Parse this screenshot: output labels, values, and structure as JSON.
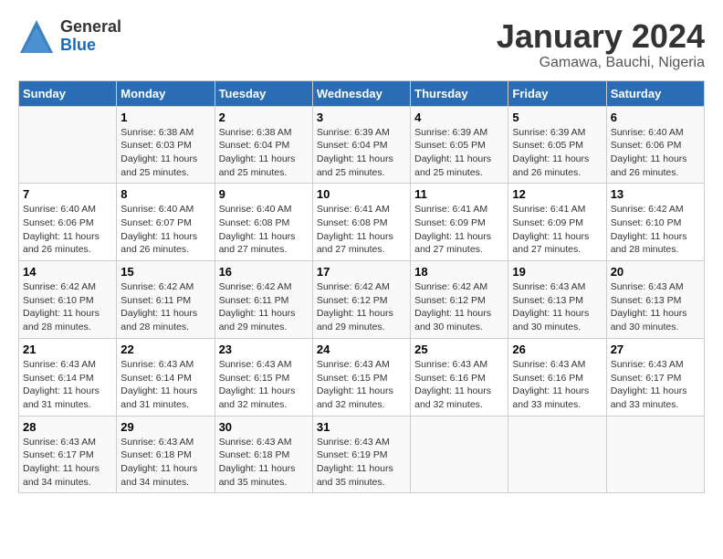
{
  "header": {
    "logo": {
      "general": "General",
      "blue": "Blue"
    },
    "title": "January 2024",
    "subtitle": "Gamawa, Bauchi, Nigeria"
  },
  "calendar": {
    "days_of_week": [
      "Sunday",
      "Monday",
      "Tuesday",
      "Wednesday",
      "Thursday",
      "Friday",
      "Saturday"
    ],
    "weeks": [
      [
        {
          "day": "",
          "info": ""
        },
        {
          "day": "1",
          "info": "Sunrise: 6:38 AM\nSunset: 6:03 PM\nDaylight: 11 hours\nand 25 minutes."
        },
        {
          "day": "2",
          "info": "Sunrise: 6:38 AM\nSunset: 6:04 PM\nDaylight: 11 hours\nand 25 minutes."
        },
        {
          "day": "3",
          "info": "Sunrise: 6:39 AM\nSunset: 6:04 PM\nDaylight: 11 hours\nand 25 minutes."
        },
        {
          "day": "4",
          "info": "Sunrise: 6:39 AM\nSunset: 6:05 PM\nDaylight: 11 hours\nand 25 minutes."
        },
        {
          "day": "5",
          "info": "Sunrise: 6:39 AM\nSunset: 6:05 PM\nDaylight: 11 hours\nand 26 minutes."
        },
        {
          "day": "6",
          "info": "Sunrise: 6:40 AM\nSunset: 6:06 PM\nDaylight: 11 hours\nand 26 minutes."
        }
      ],
      [
        {
          "day": "7",
          "info": "Sunrise: 6:40 AM\nSunset: 6:06 PM\nDaylight: 11 hours\nand 26 minutes."
        },
        {
          "day": "8",
          "info": "Sunrise: 6:40 AM\nSunset: 6:07 PM\nDaylight: 11 hours\nand 26 minutes."
        },
        {
          "day": "9",
          "info": "Sunrise: 6:40 AM\nSunset: 6:08 PM\nDaylight: 11 hours\nand 27 minutes."
        },
        {
          "day": "10",
          "info": "Sunrise: 6:41 AM\nSunset: 6:08 PM\nDaylight: 11 hours\nand 27 minutes."
        },
        {
          "day": "11",
          "info": "Sunrise: 6:41 AM\nSunset: 6:09 PM\nDaylight: 11 hours\nand 27 minutes."
        },
        {
          "day": "12",
          "info": "Sunrise: 6:41 AM\nSunset: 6:09 PM\nDaylight: 11 hours\nand 27 minutes."
        },
        {
          "day": "13",
          "info": "Sunrise: 6:42 AM\nSunset: 6:10 PM\nDaylight: 11 hours\nand 28 minutes."
        }
      ],
      [
        {
          "day": "14",
          "info": "Sunrise: 6:42 AM\nSunset: 6:10 PM\nDaylight: 11 hours\nand 28 minutes."
        },
        {
          "day": "15",
          "info": "Sunrise: 6:42 AM\nSunset: 6:11 PM\nDaylight: 11 hours\nand 28 minutes."
        },
        {
          "day": "16",
          "info": "Sunrise: 6:42 AM\nSunset: 6:11 PM\nDaylight: 11 hours\nand 29 minutes."
        },
        {
          "day": "17",
          "info": "Sunrise: 6:42 AM\nSunset: 6:12 PM\nDaylight: 11 hours\nand 29 minutes."
        },
        {
          "day": "18",
          "info": "Sunrise: 6:42 AM\nSunset: 6:12 PM\nDaylight: 11 hours\nand 30 minutes."
        },
        {
          "day": "19",
          "info": "Sunrise: 6:43 AM\nSunset: 6:13 PM\nDaylight: 11 hours\nand 30 minutes."
        },
        {
          "day": "20",
          "info": "Sunrise: 6:43 AM\nSunset: 6:13 PM\nDaylight: 11 hours\nand 30 minutes."
        }
      ],
      [
        {
          "day": "21",
          "info": "Sunrise: 6:43 AM\nSunset: 6:14 PM\nDaylight: 11 hours\nand 31 minutes."
        },
        {
          "day": "22",
          "info": "Sunrise: 6:43 AM\nSunset: 6:14 PM\nDaylight: 11 hours\nand 31 minutes."
        },
        {
          "day": "23",
          "info": "Sunrise: 6:43 AM\nSunset: 6:15 PM\nDaylight: 11 hours\nand 32 minutes."
        },
        {
          "day": "24",
          "info": "Sunrise: 6:43 AM\nSunset: 6:15 PM\nDaylight: 11 hours\nand 32 minutes."
        },
        {
          "day": "25",
          "info": "Sunrise: 6:43 AM\nSunset: 6:16 PM\nDaylight: 11 hours\nand 32 minutes."
        },
        {
          "day": "26",
          "info": "Sunrise: 6:43 AM\nSunset: 6:16 PM\nDaylight: 11 hours\nand 33 minutes."
        },
        {
          "day": "27",
          "info": "Sunrise: 6:43 AM\nSunset: 6:17 PM\nDaylight: 11 hours\nand 33 minutes."
        }
      ],
      [
        {
          "day": "28",
          "info": "Sunrise: 6:43 AM\nSunset: 6:17 PM\nDaylight: 11 hours\nand 34 minutes."
        },
        {
          "day": "29",
          "info": "Sunrise: 6:43 AM\nSunset: 6:18 PM\nDaylight: 11 hours\nand 34 minutes."
        },
        {
          "day": "30",
          "info": "Sunrise: 6:43 AM\nSunset: 6:18 PM\nDaylight: 11 hours\nand 35 minutes."
        },
        {
          "day": "31",
          "info": "Sunrise: 6:43 AM\nSunset: 6:19 PM\nDaylight: 11 hours\nand 35 minutes."
        },
        {
          "day": "",
          "info": ""
        },
        {
          "day": "",
          "info": ""
        },
        {
          "day": "",
          "info": ""
        }
      ]
    ]
  }
}
